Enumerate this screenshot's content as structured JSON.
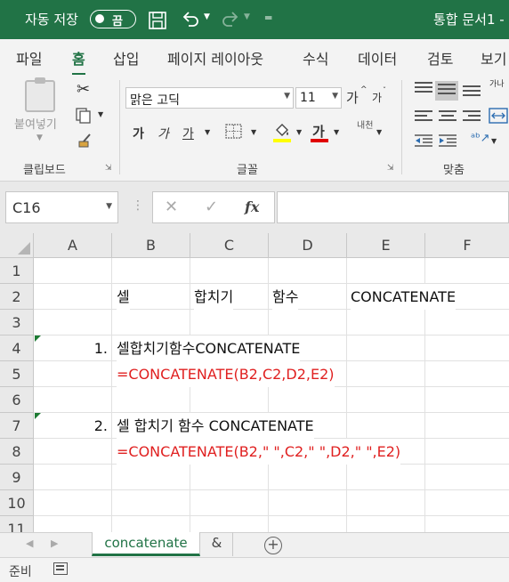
{
  "titlebar": {
    "autosave_label": "자동 저장",
    "autosave_state": "끔",
    "document_title": "통합 문서1 -"
  },
  "menu": {
    "tabs": [
      "파일",
      "홈",
      "삽입",
      "페이지 레이아웃",
      "수식",
      "데이터",
      "검토",
      "보기"
    ],
    "active_tab": "홈"
  },
  "ribbon": {
    "clipboard": {
      "paste_label": "붙여넣기",
      "group_label": "클립보드"
    },
    "font": {
      "font_name": "맑은 고딕",
      "font_size": "11",
      "grow_label": "가",
      "shrink_label": "가",
      "bold_label": "가",
      "italic_label": "가",
      "underline_label": "가",
      "font_color_label": "가",
      "phonetic_label": "내천",
      "highlight_color": "#ffff00",
      "font_color": "#e00000",
      "group_label": "글꼴"
    },
    "alignment": {
      "wrap_label": "가나",
      "group_label": "맞춤"
    }
  },
  "formula_bar": {
    "name_box": "C16",
    "formula": ""
  },
  "columns": [
    "A",
    "B",
    "C",
    "D",
    "E",
    "F"
  ],
  "rows": [
    "1",
    "2",
    "3",
    "4",
    "5",
    "6",
    "7",
    "8",
    "9",
    "10",
    "11"
  ],
  "cells": {
    "B2": "셀",
    "C2": "합치기",
    "D2": "함수",
    "E2": "CONCATENATE",
    "A4": "1.",
    "B4": "셀합치기함수CONCATENATE",
    "B5": "=CONCATENATE(B2,C2,D2,E2)",
    "A7": "2.",
    "B7": "셀 합치기 함수 CONCATENATE",
    "B8": "=CONCATENATE(B2,\" \",C2,\" \",D2,\" \",E2)"
  },
  "sheets": {
    "active": "concatenate",
    "other": "&"
  },
  "status": {
    "text": "준비"
  },
  "colors": {
    "accent": "#217346",
    "formula_text": "#e02020"
  }
}
